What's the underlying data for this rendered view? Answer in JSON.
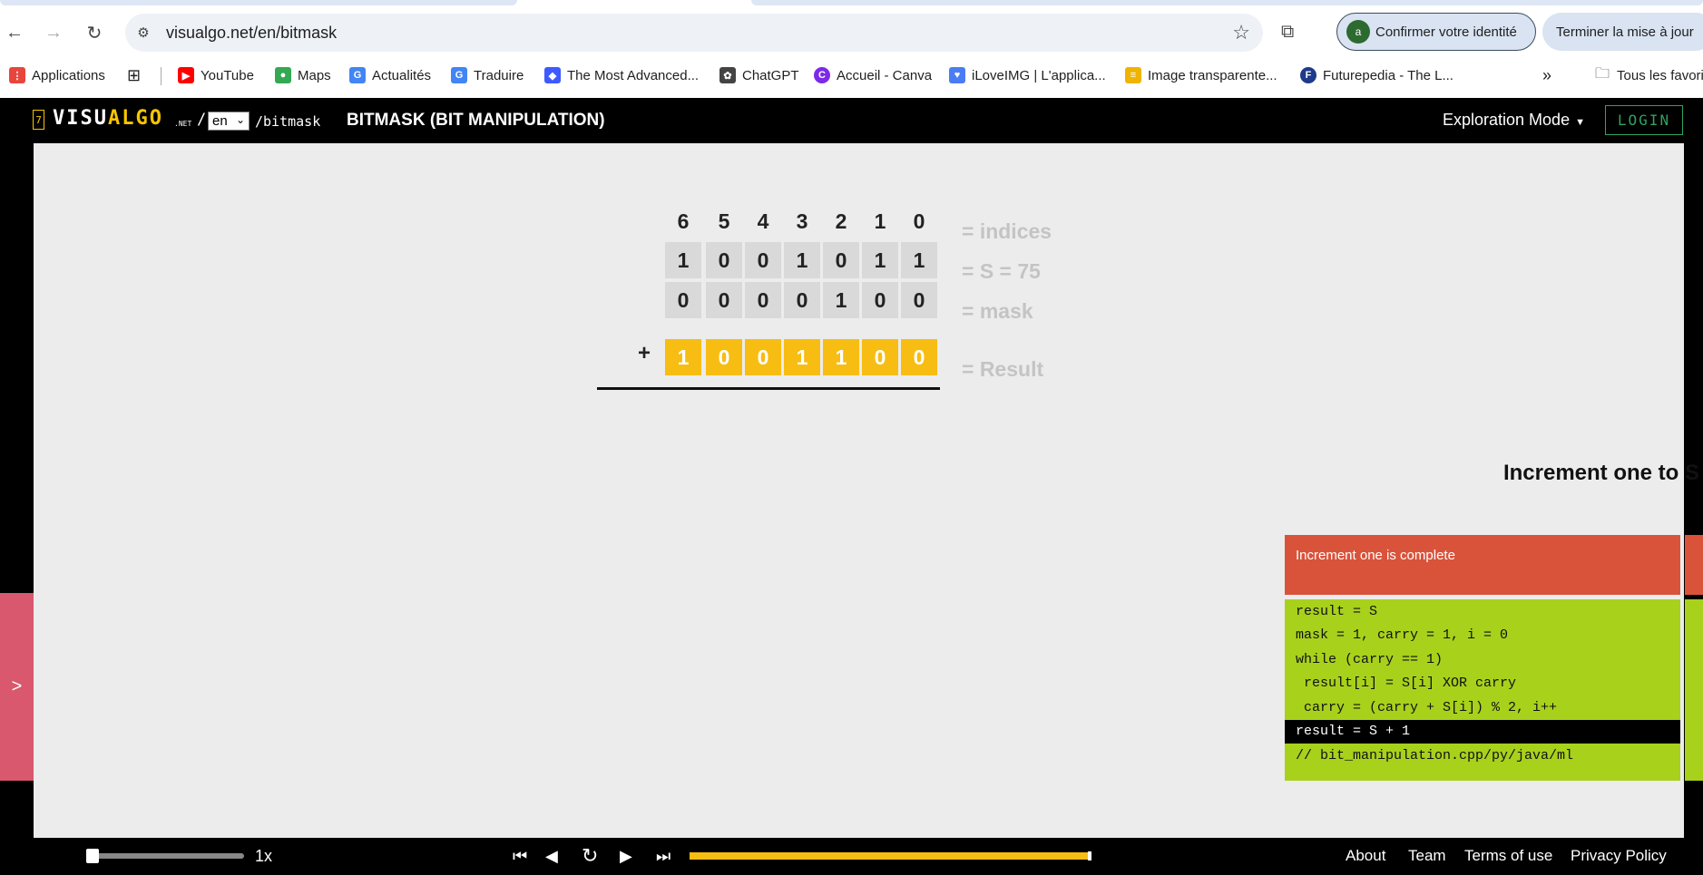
{
  "browser": {
    "url": "visualgo.net/en/bitmask",
    "confirm_identity": "Confirmer votre identité",
    "confirm_avatar": "a",
    "update_button": "Terminer la mise à jour",
    "bookmarks": [
      {
        "label": "Applications",
        "icon": "apps-grid-icon",
        "color": "#e8453c"
      },
      {
        "label": "YouTube",
        "icon": "youtube-icon",
        "color": "#ff0000"
      },
      {
        "label": "Maps",
        "icon": "maps-pin-icon",
        "color": "#34a853"
      },
      {
        "label": "Actualités",
        "icon": "news-icon",
        "color": "#4285f4"
      },
      {
        "label": "Traduire",
        "icon": "translate-icon",
        "color": "#4285f4"
      },
      {
        "label": "The Most Advanced...",
        "icon": "tool-icon",
        "color": "#3d5afe"
      },
      {
        "label": "ChatGPT",
        "icon": "chatgpt-icon",
        "color": "#444444"
      },
      {
        "label": "Accueil - Canva",
        "icon": "canva-icon",
        "color": "#7d2ae8"
      },
      {
        "label": "iLoveIMG | L'applica...",
        "icon": "heart-icon",
        "color": "#4a7cf5"
      },
      {
        "label": "Image transparente...",
        "icon": "layers-icon",
        "color": "#f0b400"
      },
      {
        "label": "Futurepedia - The L...",
        "icon": "futurepedia-icon",
        "color": "#1e3a8a"
      }
    ],
    "overflow": "»",
    "all_bookmarks": "Tous les favoris"
  },
  "app": {
    "logo_left": "VISU",
    "logo_right": "ALGO",
    "logo_net": ".NET",
    "logo_slash": "/",
    "language": "en",
    "route": "/bitmask",
    "title": "BITMASK (BIT MANIPULATION)",
    "mode": "Exploration Mode",
    "login": "LOGIN"
  },
  "bitmask": {
    "indices": [
      "6",
      "5",
      "4",
      "3",
      "2",
      "1",
      "0"
    ],
    "indices_label": "= indices",
    "s_bits": [
      "1",
      "0",
      "0",
      "1",
      "0",
      "1",
      "1"
    ],
    "s_label": "= S = 75",
    "operator": "+",
    "mask_bits": [
      "0",
      "0",
      "0",
      "0",
      "1",
      "0",
      "0"
    ],
    "mask_label": "= mask",
    "result_bits": [
      "1",
      "0",
      "0",
      "1",
      "1",
      "0",
      "0"
    ],
    "result_label": "= Result"
  },
  "panel": {
    "drawer_toggle": ">",
    "status_title": "Increment one to S",
    "status_message": "Increment one is complete",
    "code": [
      "result = S",
      "mask = 1, carry = 1, i = 0",
      "while (carry == 1)",
      " result[i] = S[i] XOR carry",
      " carry = (carry + S[i]) % 2, i++",
      "result = S + 1",
      "// bit_manipulation.cpp/py/java/ml"
    ],
    "highlighted_line": 5
  },
  "playback": {
    "speed": "1x",
    "progress_fraction": 0.99
  },
  "footer": {
    "about": "About",
    "team": "Team",
    "terms": "Terms of use",
    "privacy": "Privacy Policy"
  },
  "colors": {
    "result_bit": "#f7bd12",
    "status_bg": "#d9533b",
    "code_bg": "#a8d11c",
    "drawer_bg": "#d9586e",
    "login": "#2fa360"
  }
}
